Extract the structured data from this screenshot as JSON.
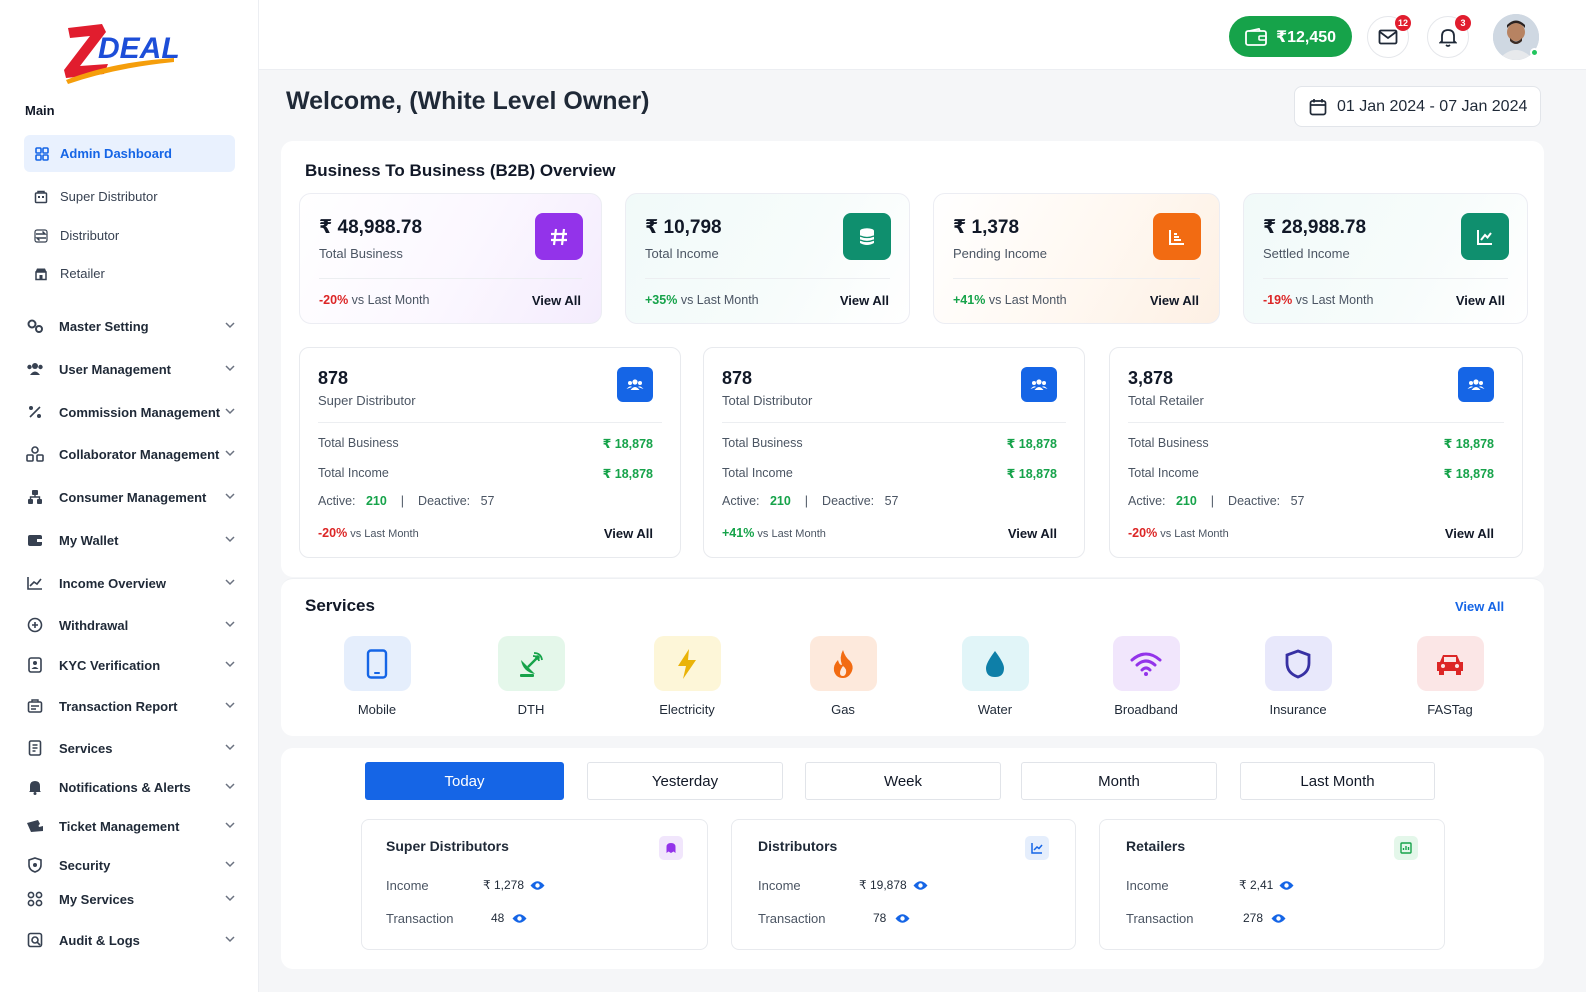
{
  "app": {
    "logo_text": "ZDEAL"
  },
  "sidebar": {
    "main_label": "Main",
    "active_item": "Admin Dashboard",
    "sub_items": [
      "Super Distributor",
      "Distributor",
      "Retailer"
    ],
    "menu_items": [
      "Master Setting",
      "User Management",
      "Commission Management",
      "Collaborator Management",
      "Consumer Management",
      "My Wallet",
      "Income Overview",
      "Withdrawal",
      "KYC Verification",
      "Transaction Report",
      "Services",
      "Notifications & Alerts",
      "Ticket Management",
      "Security",
      "My Services",
      "Audit & Logs"
    ]
  },
  "topbar": {
    "wallet_balance": "₹12,450",
    "mail_count": "12",
    "notification_count": "3"
  },
  "welcome": "Welcome, (White Level Owner)",
  "date_range": "01 Jan 2024 - 07 Jan 2024",
  "b2b": {
    "title": "Business To Business (B2B) Overview",
    "cards": [
      {
        "value": "₹ 48,988.78",
        "label": "Total Business",
        "change": "-20%",
        "change_text": "vs Last Month",
        "view": "View All",
        "icon": "hash-icon",
        "color": "#9333ea"
      },
      {
        "value": "₹ 10,798",
        "label": "Total Income",
        "change": "+35%",
        "change_text": "vs Last Month",
        "view": "View All",
        "icon": "database-icon",
        "color": "#0f8f6e"
      },
      {
        "value": "₹ 1,378",
        "label": "Pending Income",
        "change": "+41%",
        "change_text": "vs Last Month",
        "view": "View All",
        "icon": "report-icon",
        "color": "#f26b12"
      },
      {
        "value": "₹ 28,988.78",
        "label": "Settled Income",
        "change": "-19%",
        "change_text": "vs Last Month",
        "view": "View All",
        "icon": "chart-line-icon",
        "color": "#0f8f6e"
      }
    ],
    "network": [
      {
        "value": "878",
        "label": "Super Distributor",
        "business_label": "Total Business",
        "business": "₹ 18,878",
        "income_label": "Total Income",
        "income": "₹ 18,878",
        "active_label": "Active:",
        "active": "210",
        "sep": "|",
        "deactive_label": "Deactive:",
        "deactive": "57",
        "change": "-20%",
        "change_text": "vs Last Month",
        "view": "View All"
      },
      {
        "value": "878",
        "label": "Total Distributor",
        "business_label": "Total Business",
        "business": "₹ 18,878",
        "income_label": "Total Income",
        "income": "₹ 18,878",
        "active_label": "Active:",
        "active": "210",
        "sep": "|",
        "deactive_label": "Deactive:",
        "deactive": "57",
        "change": "+41%",
        "change_text": "vs Last Month",
        "view": "View All"
      },
      {
        "value": "3,878",
        "label": "Total Retailer",
        "business_label": "Total Business",
        "business": "₹ 18,878",
        "income_label": "Total Income",
        "income": "₹ 18,878",
        "active_label": "Active:",
        "active": "210",
        "sep": "|",
        "deactive_label": "Deactive:",
        "deactive": "57",
        "change": "-20%",
        "change_text": "vs Last Month",
        "view": "View All"
      }
    ]
  },
  "services": {
    "title": "Services",
    "view_all": "View All",
    "items": [
      {
        "label": "Mobile",
        "icon": "mobile-icon",
        "color": "#1565e6"
      },
      {
        "label": "DTH",
        "icon": "satellite-dish-icon",
        "color": "#16a34a"
      },
      {
        "label": "Electricity",
        "icon": "lightning-icon",
        "color": "#eab308"
      },
      {
        "label": "Gas",
        "icon": "flame-icon",
        "color": "#f26b12"
      },
      {
        "label": "Water",
        "icon": "water-drop-icon",
        "color": "#0e7fa8"
      },
      {
        "label": "Broadband",
        "icon": "wifi-icon",
        "color": "#9333ea"
      },
      {
        "label": "Insurance",
        "icon": "shield-icon",
        "color": "#3730a3"
      },
      {
        "label": "FASTag",
        "icon": "car-icon",
        "color": "#dc2626"
      }
    ]
  },
  "period_tabs": {
    "items": [
      "Today",
      "Yesterday",
      "Week",
      "Month",
      "Last Month"
    ],
    "active": "Today"
  },
  "summary_cards": [
    {
      "title": "Super Distributors",
      "income_label": "Income",
      "income": "₹ 1,278",
      "txn_label": "Transaction",
      "txn": "48",
      "icon": "ghost-icon"
    },
    {
      "title": "Distributors",
      "income_label": "Income",
      "income": "₹ 19,878",
      "txn_label": "Transaction",
      "txn": "78",
      "icon": "chart-line-icon"
    },
    {
      "title": "Retailers",
      "income_label": "Income",
      "income": "₹ 2,41",
      "txn_label": "Transaction",
      "txn": "278",
      "icon": "report-icon"
    }
  ]
}
